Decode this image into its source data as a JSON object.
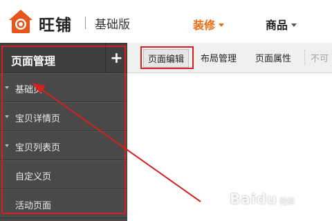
{
  "header": {
    "brand": "旺铺",
    "edition": "基础版",
    "nav": [
      {
        "label": "装修",
        "active": true
      },
      {
        "label": "商品",
        "active": false
      }
    ]
  },
  "sidebar": {
    "title": "页面管理",
    "add_label": "+",
    "items": [
      {
        "label": "基础页",
        "expandable": true
      },
      {
        "label": "宝贝详情页",
        "expandable": true
      },
      {
        "label": "宝贝列表页",
        "expandable": true
      },
      {
        "label": "自定义页",
        "expandable": false
      },
      {
        "label": "活动页面",
        "expandable": false
      }
    ]
  },
  "toolbar": {
    "tabs": [
      {
        "label": "页面编辑",
        "active": true
      },
      {
        "label": "布局管理",
        "active": false
      },
      {
        "label": "页面属性",
        "active": false
      },
      {
        "label": "不可",
        "active": false
      }
    ]
  },
  "watermark": {
    "text": "Baidu",
    "sub": "经验"
  },
  "colors": {
    "accent": "#f06a10",
    "sidebar_bg": "#494949",
    "highlight": "#d42020"
  }
}
